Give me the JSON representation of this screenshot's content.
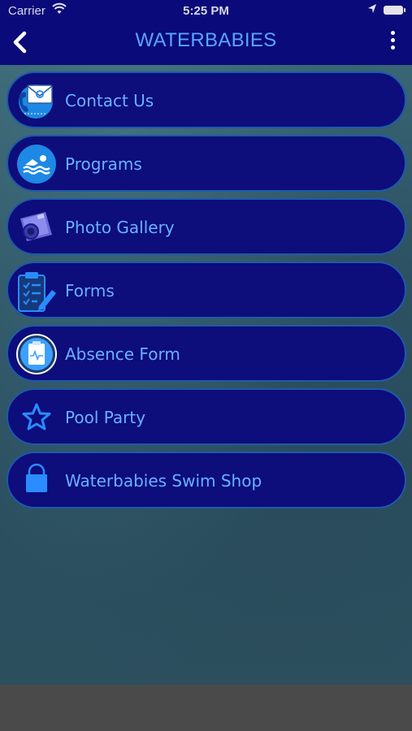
{
  "status_bar": {
    "carrier": "Carrier",
    "time": "5:25 PM"
  },
  "header": {
    "title": "WATERBABIES",
    "back_icon": "chevron-left-icon",
    "more_icon": "more-vertical-icon"
  },
  "menu": {
    "items": [
      {
        "label": "Contact Us",
        "icon": "contact-icon"
      },
      {
        "label": "Programs",
        "icon": "swimmer-icon"
      },
      {
        "label": "Photo Gallery",
        "icon": "camera-icon"
      },
      {
        "label": "Forms",
        "icon": "clipboard-pencil-icon"
      },
      {
        "label": "Absence Form",
        "icon": "clipboard-heartbeat-icon"
      },
      {
        "label": "Pool Party",
        "icon": "star-icon"
      },
      {
        "label": "Waterbabies Swim Shop",
        "icon": "shopping-bag-icon"
      }
    ]
  },
  "colors": {
    "header_bg": "#0a0a7a",
    "item_bg": "#0d0d7c",
    "item_border": "#1e5aa8",
    "title": "#5aa4ff",
    "label": "#6ab0ff"
  }
}
